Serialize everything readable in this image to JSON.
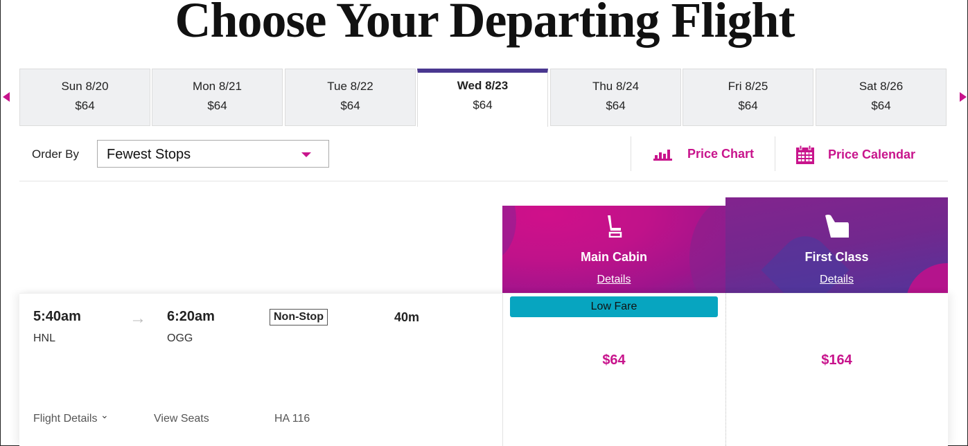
{
  "page": {
    "title": "Choose Your Departing Flight"
  },
  "colors": {
    "accent": "#c8148c",
    "active_tab": "#4a3790",
    "low_fare": "#07a5c0"
  },
  "date_nav": {
    "prev_icon": "triangle-left-icon",
    "next_icon": "triangle-right-icon",
    "tabs": [
      {
        "day": "Sun 8/20",
        "price": "$64",
        "active": false
      },
      {
        "day": "Mon 8/21",
        "price": "$64",
        "active": false
      },
      {
        "day": "Tue 8/22",
        "price": "$64",
        "active": false
      },
      {
        "day": "Wed 8/23",
        "price": "$64",
        "active": true
      },
      {
        "day": "Thu 8/24",
        "price": "$64",
        "active": false
      },
      {
        "day": "Fri 8/25",
        "price": "$64",
        "active": false
      },
      {
        "day": "Sat 8/26",
        "price": "$64",
        "active": false
      }
    ]
  },
  "toolbar": {
    "order_by_label": "Order By",
    "order_by_value": "Fewest Stops",
    "price_chart": {
      "label": "Price Chart",
      "icon": "bar-chart-icon"
    },
    "price_calendar": {
      "label": "Price Calendar",
      "icon": "calendar-icon"
    }
  },
  "cabins": [
    {
      "name": "Main Cabin",
      "details": "Details",
      "icon": "seat-icon"
    },
    {
      "name": "First Class",
      "details": "Details",
      "icon": "premium-seat-icon"
    }
  ],
  "flight": {
    "depart_time": "5:40am",
    "depart_airport": "HNL",
    "arrow": "→",
    "arrive_time": "6:20am",
    "arrive_airport": "OGG",
    "stops": "Non-Stop",
    "duration": "40m",
    "flight_details": "Flight Details",
    "flight_details_chevron": "⌄",
    "view_seats": "View Seats",
    "flight_number": "HA 116",
    "fares": {
      "badge": "Low Fare",
      "main_cabin_price": "$64",
      "first_class_price": "$164"
    }
  }
}
